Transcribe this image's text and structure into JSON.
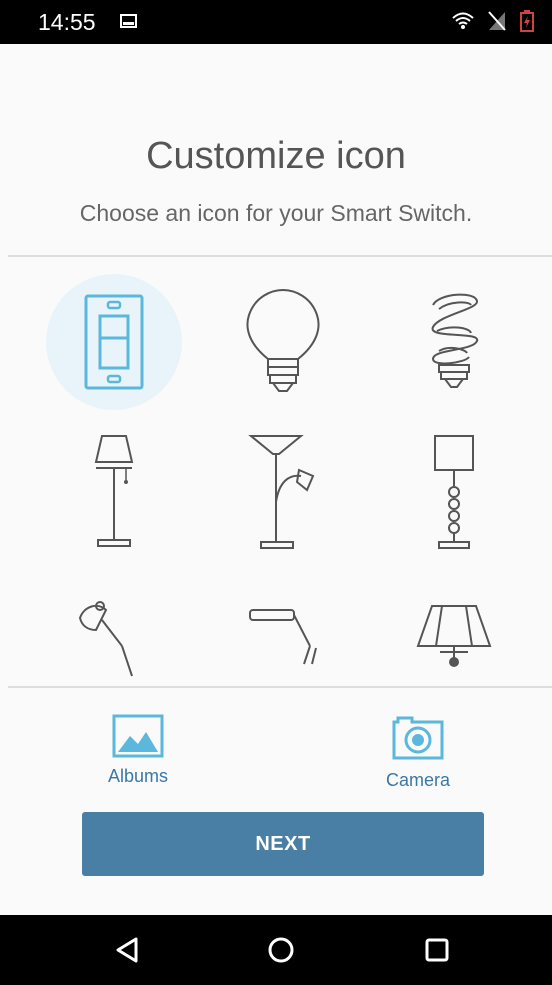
{
  "status_bar": {
    "time": "14:55",
    "icons": [
      "image-notification-icon",
      "wifi-icon",
      "no-signal-icon",
      "battery-charging-icon"
    ]
  },
  "header": {
    "title": "Customize icon",
    "subtitle": "Choose an icon for your Smart Switch."
  },
  "icon_grid": {
    "selected_index": 0,
    "items": [
      {
        "name": "wall-switch-icon",
        "selected": true
      },
      {
        "name": "light-bulb-icon",
        "selected": false
      },
      {
        "name": "cfl-spiral-bulb-icon",
        "selected": false
      },
      {
        "name": "table-lamp-icon",
        "selected": false
      },
      {
        "name": "floor-lamp-icon",
        "selected": false
      },
      {
        "name": "column-lamp-icon",
        "selected": false
      },
      {
        "name": "desk-lamp-icon",
        "selected": false
      },
      {
        "name": "strip-light-icon",
        "selected": false
      },
      {
        "name": "pendant-lamp-icon",
        "selected": false
      }
    ]
  },
  "media": {
    "albums_label": "Albums",
    "camera_label": "Camera"
  },
  "actions": {
    "next_label": "NEXT"
  },
  "colors": {
    "accent": "#4a7fa5",
    "icon_selected": "#5bb8dc",
    "icon_default": "#555555",
    "selected_halo": "#e9f4fa",
    "link": "#3a78a6"
  },
  "nav_bar": {
    "icons": [
      "back-icon",
      "home-icon",
      "recents-icon"
    ]
  }
}
